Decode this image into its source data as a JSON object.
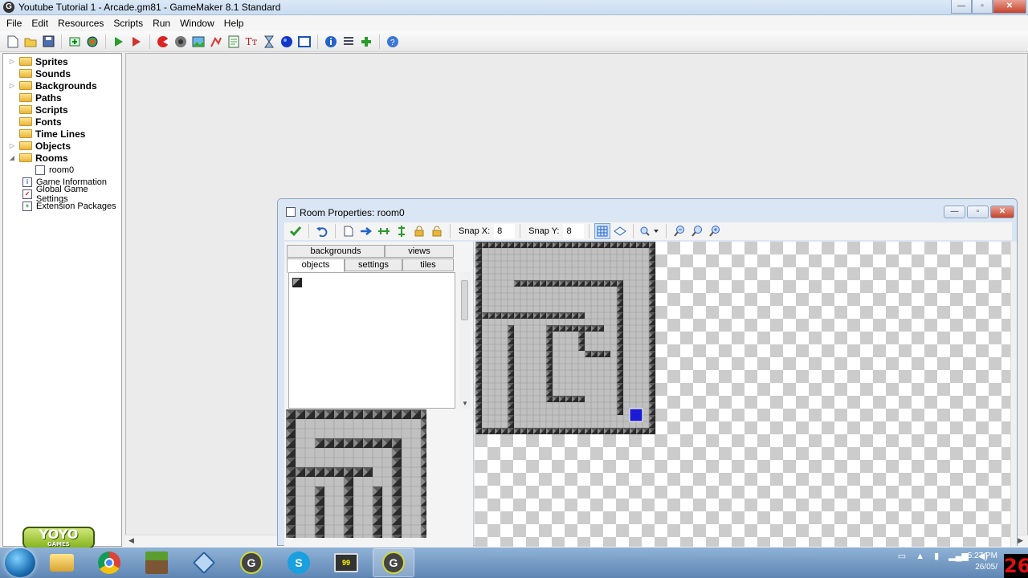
{
  "window": {
    "title": "Youtube Tutorial 1 - Arcade.gm81 - GameMaker 8.1 Standard",
    "app_icon": "G",
    "controls": {
      "minimize": "—",
      "maximize": "▫",
      "close": "✕"
    }
  },
  "menu": [
    "File",
    "Edit",
    "Resources",
    "Scripts",
    "Run",
    "Window",
    "Help"
  ],
  "toolbar": {
    "icons": [
      "new-file-icon",
      "open-folder-icon",
      "save-icon",
      "export-icon",
      "publish-icon",
      "run-icon",
      "debug-icon",
      "create-sprite-icon",
      "create-sound-icon",
      "create-background-icon",
      "create-path-icon",
      "create-script-icon",
      "create-font-icon",
      "create-timeline-icon",
      "create-object-icon",
      "create-room-icon",
      "game-info-icon",
      "global-settings-icon",
      "extension-icon",
      "help-icon"
    ]
  },
  "tree": {
    "folders": [
      {
        "label": "Sprites",
        "expander": "▷"
      },
      {
        "label": "Sounds",
        "expander": ""
      },
      {
        "label": "Backgrounds",
        "expander": "▷"
      },
      {
        "label": "Paths",
        "expander": ""
      },
      {
        "label": "Scripts",
        "expander": ""
      },
      {
        "label": "Fonts",
        "expander": ""
      },
      {
        "label": "Time Lines",
        "expander": ""
      },
      {
        "label": "Objects",
        "expander": "▷"
      },
      {
        "label": "Rooms",
        "expander": "◢"
      }
    ],
    "room_child": "room0",
    "leaves": [
      {
        "label": "Game Information",
        "icon": "i"
      },
      {
        "label": "Global Game Settings",
        "icon": "✓"
      },
      {
        "label": "Extension Packages",
        "icon": "+"
      }
    ]
  },
  "logo": {
    "text": "YOYO",
    "sub": "GAMES"
  },
  "room_window": {
    "title": "Room Properties: room0",
    "snap_x_label": "Snap X:",
    "snap_x_value": "8",
    "snap_y_label": "Snap Y:",
    "snap_y_value": "8",
    "tabs_back": [
      "backgrounds",
      "views"
    ],
    "tabs_front": [
      "objects",
      "settings",
      "tiles"
    ],
    "active_tab": "objects",
    "controls": {
      "minimize": "—",
      "maximize": "▫",
      "close": "✕"
    }
  },
  "taskbar": {
    "clock_time": "5:27 PM",
    "clock_date": "26/05/",
    "counter": "26"
  },
  "colors": {
    "wall_dark": "#2a2a2a",
    "wall_light": "#8a8a8a",
    "floor": "#c0c0c0",
    "player": "#1b1bd6"
  }
}
